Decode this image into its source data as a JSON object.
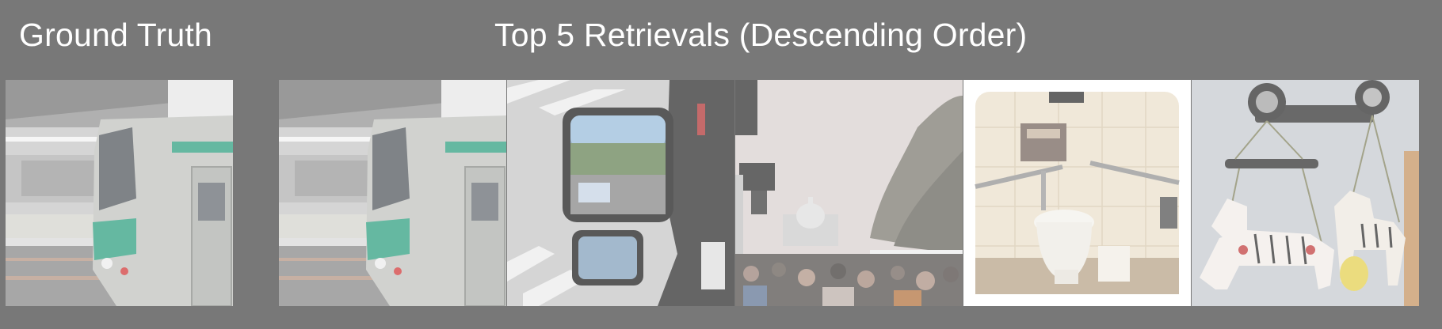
{
  "ground_truth": {
    "title": "Ground Truth",
    "image": "train-at-station"
  },
  "retrievals": {
    "title": "Top 5 Retrievals (Descending Order)",
    "images": [
      "train-at-station",
      "truck-side-mirror-crosswalk",
      "crowd-on-avenue-capitol",
      "restroom-toilet",
      "hanging-zebra-figures"
    ]
  }
}
